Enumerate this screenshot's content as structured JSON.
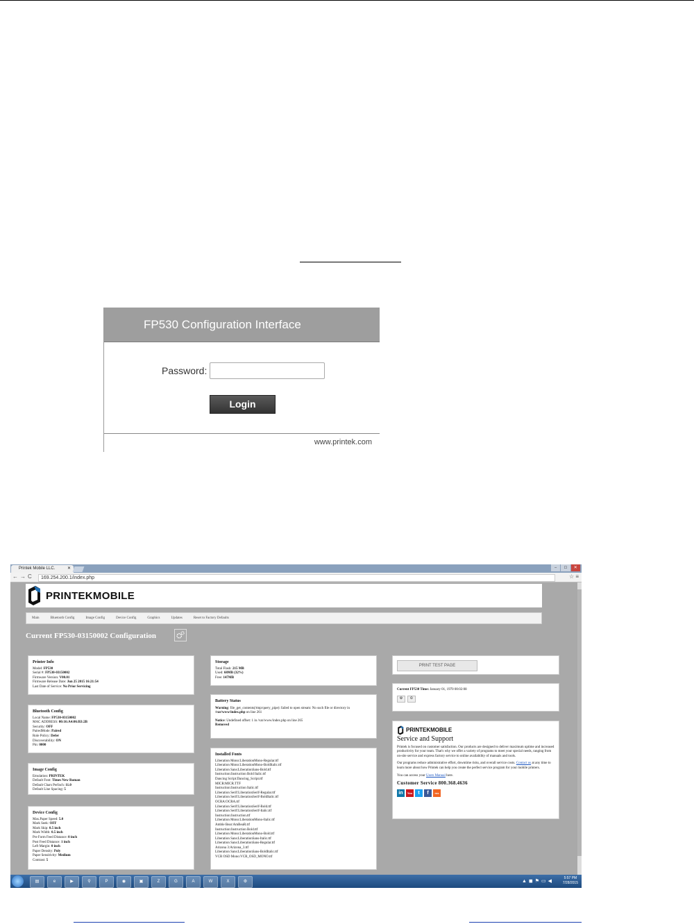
{
  "login": {
    "title": "FP530 Configuration Interface",
    "password_label": "Password:",
    "password_value": "",
    "login_button": "Login",
    "footer_site": "www.printek.com"
  },
  "browser": {
    "tab_title": "Printek Mobile LLC.",
    "url": "169.254.200.1/index.php"
  },
  "app": {
    "logo_text": "PRINTEKMOBILE",
    "menu": [
      "Main",
      "Bluetooth Config",
      "Image Config",
      "Device Config",
      "Graphics",
      "Updates",
      "Reset to Factory Defaults"
    ],
    "page_title": "Current FP530-03150002 Configuration",
    "printer_info": {
      "title": "Printer Info",
      "rows": [
        {
          "k": "Model:",
          "v": "FP530"
        },
        {
          "k": "Serial #:",
          "v": "FP530-03150002"
        },
        {
          "k": "Firmware Version:",
          "v": "V00.01"
        },
        {
          "k": "Firmware Release Date:",
          "v": "Jun 25 2015 16:21:54"
        },
        {
          "k": "Last Date of Service:",
          "v": "No Prior Servicing"
        }
      ]
    },
    "bluetooth_config": {
      "title": "Bluetooth Config",
      "rows": [
        {
          "k": "Local Name:",
          "v": "FP530-03150002"
        },
        {
          "k": "MAC ADDRESS:",
          "v": "00:16:A4:06:B3:2B"
        },
        {
          "k": "Security:",
          "v": "OFF"
        },
        {
          "k": "PairedMode:",
          "v": "Paired"
        },
        {
          "k": "Role Policy:",
          "v": "Defer"
        },
        {
          "k": "Discoverability:",
          "v": "ON"
        },
        {
          "k": "Pin:",
          "v": "0000"
        }
      ]
    },
    "image_config": {
      "title": "Image Config",
      "rows": [
        {
          "k": "Emulation:",
          "v": "PRINTEK"
        },
        {
          "k": "Default Font:",
          "v": "Times New Roman"
        },
        {
          "k": "Default Chars PerInch:",
          "v": "11.0"
        },
        {
          "k": "Default Line Spacing:",
          "v": "5"
        }
      ]
    },
    "device_config": {
      "title": "Device Config",
      "rows": [
        {
          "k": "Max.Paper Speed:",
          "v": "5.0"
        },
        {
          "k": "Mark Seek:",
          "v": "OFF"
        },
        {
          "k": "Mark Skip:",
          "v": "0.5 inch"
        },
        {
          "k": "Mark Width:",
          "v": "0.5 inch"
        },
        {
          "k": "Pre Form Feed Distance:",
          "v": "0 inch"
        },
        {
          "k": "Post Feed Distance:",
          "v": "1 inch"
        },
        {
          "k": "Left Margin:",
          "v": "0 inch"
        },
        {
          "k": "Paper Density:",
          "v": "Poly"
        },
        {
          "k": "Paper Sensitivity:",
          "v": "Medium"
        },
        {
          "k": "Contrast:",
          "v": "5"
        }
      ]
    },
    "storage": {
      "title": "Storage",
      "rows": [
        {
          "k": "Total Flash:",
          "v": "215 MB"
        },
        {
          "k": "Used:",
          "v": "68MB (32%)"
        },
        {
          "k": "Free:",
          "v": "147MB"
        }
      ]
    },
    "battery_status": {
      "title": "Battery Status",
      "warning_label": "Warning",
      "warning_text": ": file_get_contents(/tmp/query_pipe): failed to open stream: No such file or directory in",
      "warning_path": "/var/www/index.php",
      "warning_line": " on line 261",
      "notice_label": "Notice",
      "notice_text": ": Undefined offset: 1 in /var/www/index.php on line 265",
      "removed": "Removed"
    },
    "installed_fonts": {
      "title": "Installed Fonts",
      "list": [
        "Liberation Mono:LiberationMono-Regular.ttf",
        "Liberation Mono:LiberationMono-BoldItalic.ttf",
        "Liberation Sans:LiberationSans-Bold.ttf",
        "Instruction:Instruction Bold Italic.ttf",
        "Dancing Script:Dancing_Script.ttf",
        "MICR:MICR.TTF",
        "Instruction:Instruction Italic.ttf",
        "Liberation Serif:LiberationSerif-Regular.ttf",
        "Liberation Serif:LiberationSerif-BoldItalic.ttf",
        "OCRA:OCRA.ttf",
        "Liberation Serif:LiberationSerif-Bold.ttf",
        "Liberation Serif:LiberationSerif-Italic.ttf",
        "Instruction:Instruction.ttf",
        "Liberation Mono:LiberationMono-Italic.ttf",
        "Amble Bear:AmBeaR.ttf",
        "Instruction:Instruction Bold.ttf",
        "Liberation Mono:LiberationMono-Bold.ttf",
        "Liberation Sans:LiberationSans-Italic.ttf",
        "Liberation Sans:LiberationSans-Regular.ttf",
        "Arizona 3:Arizona_3.ttf",
        "Liberation Sans:LiberationSans-BoldItalic.ttf",
        "VCR OSD Mono:VCR_OSD_MONO.ttf"
      ]
    },
    "test_page": {
      "button": "PRINT TEST PAGE"
    },
    "time": {
      "label": "Current FP530 Time:",
      "value": "January 01, 1970 00:02:08",
      "btn1": "⚙",
      "btn2": "⏲"
    },
    "service": {
      "logo_text": "PRINTEKMOBILE",
      "title": "Service and Support",
      "p1": "Printek is focused on customer satisfaction. Our products are designed to deliver maximum uptime and increased productivity for your team. That's why we offer a variety of programs to meet your special needs, ranging from on-site service and express factory service to online availability of manuals and tools.",
      "p2_a": "Our programs reduce administrative effort, downtime risks, and overall service costs. ",
      "p2_link": "Contact us",
      "p2_b": " at any time to learn more about how Printek can help you create the perfect service program for your mobile printers.",
      "p3_a": "You can access your ",
      "p3_link": "Users Manual",
      "p3_b": " here.",
      "phone": "Customer Service 800.368.4636",
      "socials": [
        "in",
        "You",
        "t",
        "f",
        "rss"
      ]
    }
  },
  "taskbar": {
    "time": "5:57 PM",
    "date": "7/28/2015"
  },
  "colors": {
    "login_header": "#9e9e9e",
    "page_background": "#a9a9a9",
    "taskbar": "#1d4a7e",
    "logo_accent": "#1e6fb5"
  }
}
